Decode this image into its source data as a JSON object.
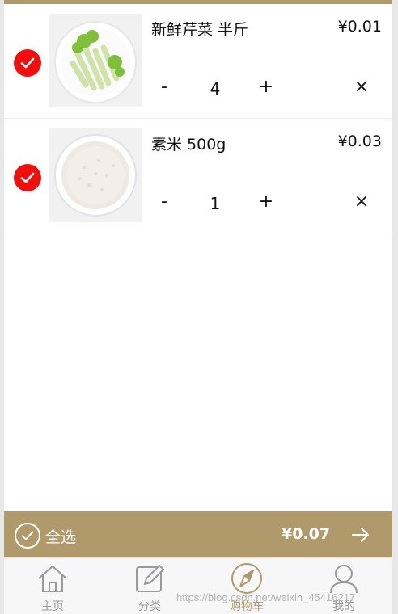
{
  "cart": {
    "items": [
      {
        "title": "新鲜芹菜 半斤",
        "price": "¥0.01",
        "minus": "-",
        "quantity": "4",
        "plus": "+",
        "remove": "×",
        "selected": true,
        "image_icon": "celery-image"
      },
      {
        "title": "素米 500g",
        "price": "¥0.03",
        "minus": "-",
        "quantity": "1",
        "plus": "+",
        "remove": "×",
        "selected": true,
        "image_icon": "rice-image"
      }
    ]
  },
  "checkout": {
    "select_all_label": "全选",
    "total": "¥0.07",
    "arrow_icon": "arrow-right-icon"
  },
  "tabbar": {
    "tabs": [
      {
        "label": "主页",
        "icon": "home-icon",
        "active": false
      },
      {
        "label": "分类",
        "icon": "edit-icon",
        "active": false
      },
      {
        "label": "购物车",
        "icon": "compass-icon",
        "active": true
      },
      {
        "label": "我的",
        "icon": "user-icon",
        "active": false
      }
    ]
  },
  "watermark": "https://blog.csdn.net/weixin_45416217",
  "colors": {
    "accent": "#b09a6c",
    "check_red": "#f30d0d"
  }
}
